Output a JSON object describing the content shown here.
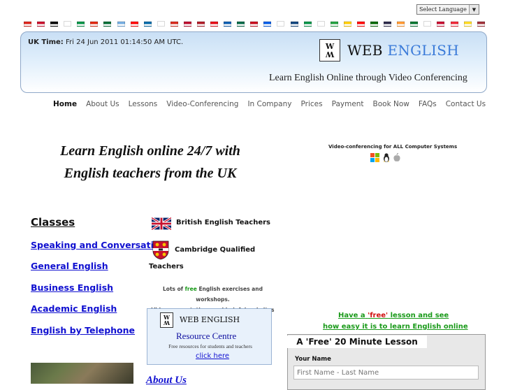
{
  "language_select": {
    "value": "Select Language"
  },
  "flags": [
    "vietnam",
    "cuba",
    "germany",
    "korea",
    "italy",
    "china",
    "saudi-arabia",
    "argentina",
    "taiwan",
    "sweden",
    "russia",
    "switzerland",
    "norway",
    "netherlands",
    "turkey",
    "greece",
    "mexico",
    "spain",
    "slovenia",
    "japan",
    "czech",
    "italy-2",
    "finland",
    "iran",
    "venezuela",
    "croatia",
    "portugal",
    "thailand",
    "india",
    "uae",
    "poland",
    "denmark",
    "austria",
    "belgium",
    "latvia"
  ],
  "flag_colors": [
    "#da251d",
    "#c8102e",
    "#000000",
    "#ffffff",
    "#009246",
    "#de2910",
    "#006c35",
    "#74acdf",
    "#fe0000",
    "#006aa7",
    "#ffffff",
    "#d52b1e",
    "#ba0c2f",
    "#ae1c28",
    "#e30a17",
    "#0d5eaf",
    "#006847",
    "#c60b1e",
    "#005ce5",
    "#ffffff",
    "#11457e",
    "#009246",
    "#ffffff",
    "#239f40",
    "#ffcc00",
    "#ff0000",
    "#006600",
    "#2d2a4a",
    "#ff9933",
    "#00732f",
    "#ffffff",
    "#c60c30",
    "#ed2939",
    "#fdda24",
    "#9e3039"
  ],
  "header": {
    "uk_time_label": "UK Time:",
    "uk_time_value": "Fri 24 Jun 2011 01:14:50 AM UTC.",
    "brand_web": "WEB",
    "brand_english": "ENGLISH",
    "logo_letters": "W",
    "tagline": "Learn English Online through Video Conferencing"
  },
  "nav": {
    "items": [
      {
        "label": "Home"
      },
      {
        "label": "About Us"
      },
      {
        "label": "Lessons"
      },
      {
        "label": "Video-Conferencing"
      },
      {
        "label": "In Company"
      },
      {
        "label": "Prices"
      },
      {
        "label": "Payment"
      },
      {
        "label": "Book Now"
      },
      {
        "label": "FAQs"
      },
      {
        "label": "Contact Us"
      }
    ]
  },
  "hero": {
    "line1": "Learn English online 24/7 with",
    "line2": "English teachers from the UK",
    "vc_text": "Video-conferencing for ALL Computer Systems"
  },
  "classes": {
    "heading": "Classes",
    "links": [
      {
        "label": "Speaking and Conversation"
      },
      {
        "label": "General English"
      },
      {
        "label": "Business English"
      },
      {
        "label": "Academic English"
      },
      {
        "label": "English by Telephone"
      }
    ]
  },
  "middle": {
    "british": "British English Teachers",
    "cambridge1": "Cambridge Qualified",
    "cambridge2": "Teachers",
    "lots1": "Lots of",
    "free": "free",
    "lots2": "English exercises and workshops.",
    "lots3": "Video presentations and helpful websites"
  },
  "resource": {
    "title": "WEB ENGLISH",
    "subtitle": "Resource Centre",
    "desc": "Free resources for students and teachers",
    "link": "click here"
  },
  "free_lesson": {
    "pre": "Have a",
    "free": "'free'",
    "post": "lesson and see",
    "line2": "how easy it is to learn English online"
  },
  "form": {
    "heading": "A 'Free' 20 Minute Lesson",
    "name_label": "Your Name",
    "name_placeholder": "First Name - Last Name"
  },
  "about_heading": "About Us"
}
